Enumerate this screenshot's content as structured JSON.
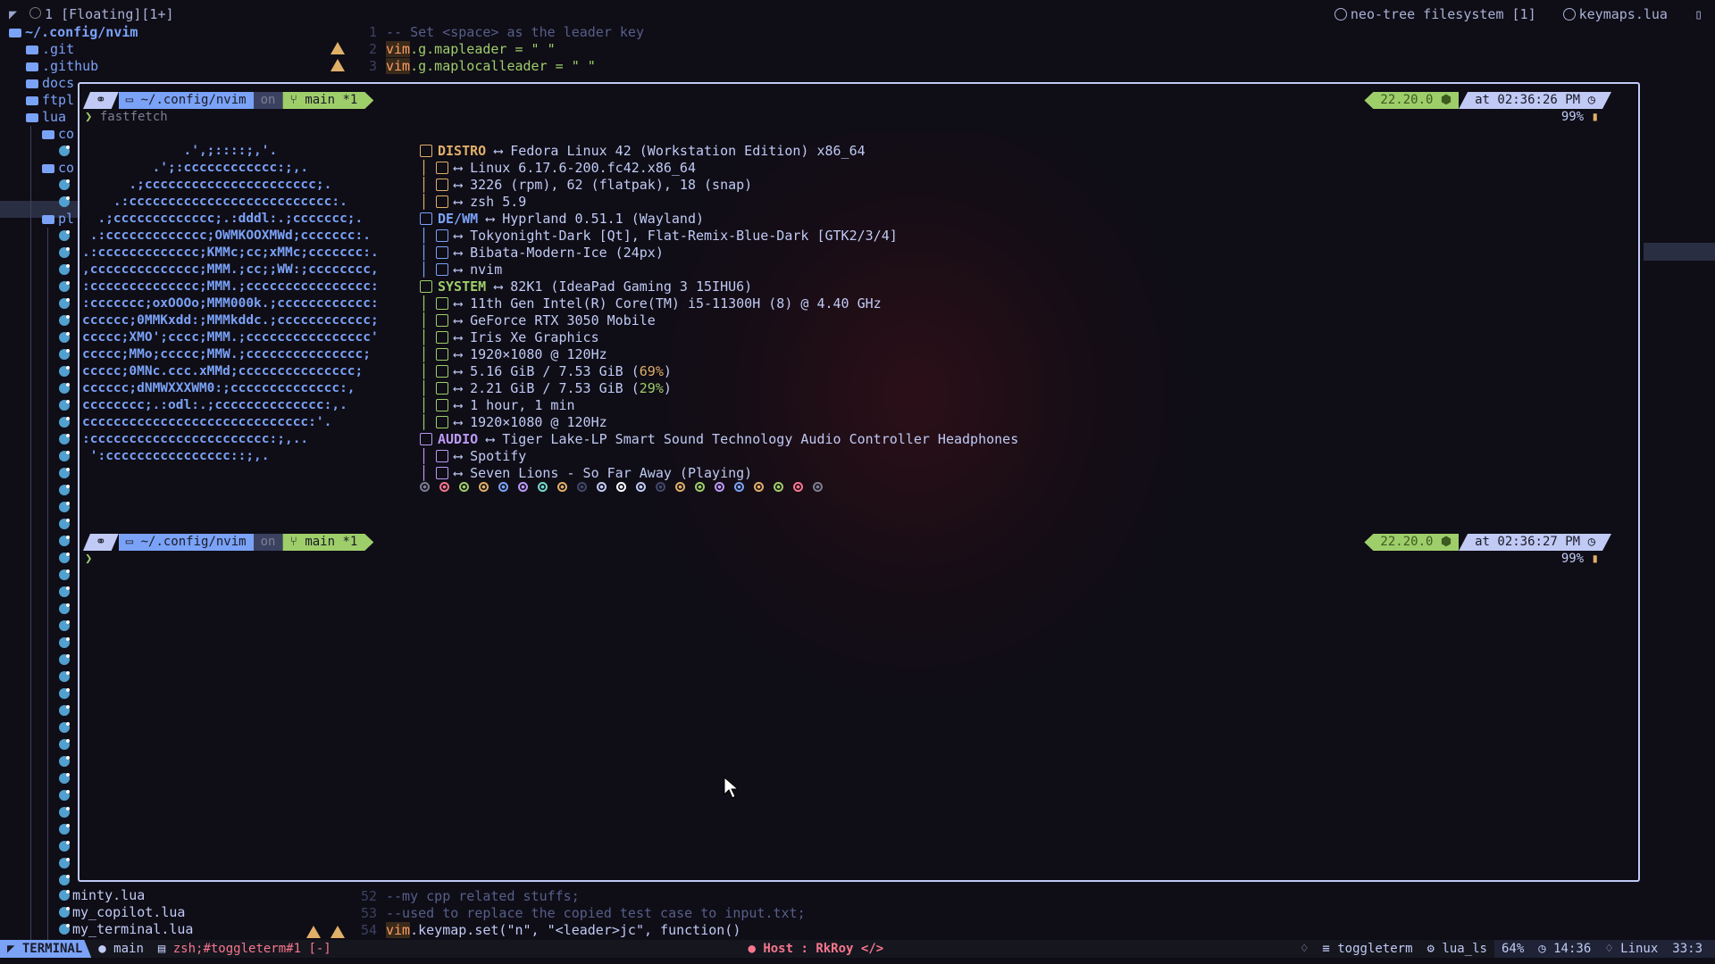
{
  "top_bar": {
    "workspace": "1 [Floating][1+]",
    "tabs": [
      "neo-tree filesystem [1]",
      "keymaps.lua"
    ]
  },
  "tree": {
    "root": "~/.config/nvim",
    "folders": [
      ".git",
      ".github",
      "docs",
      "ftpl",
      "lua",
      "co",
      "co",
      "pl"
    ],
    "files": [
      "minty.lua",
      "my_copilot.lua",
      "my_terminal.lua"
    ]
  },
  "editor": {
    "top_lines": [
      {
        "n": "1",
        "text": "-- Set <space> as the leader key"
      },
      {
        "n": "2",
        "kw": "vim",
        "text": ".g.mapleader = \" \""
      },
      {
        "n": "3",
        "kw": "vim",
        "text": ".g.maplocalleader = \" \""
      }
    ],
    "bottom_lines": [
      {
        "n": "52",
        "text": "--my cpp related stuffs;"
      },
      {
        "n": "53",
        "text": "--used to replace the copied test case to input.txt;"
      },
      {
        "n": "54",
        "kw": "vim",
        "text": ".keymap.set(\"n\", \"<leader>jc\", function()"
      }
    ]
  },
  "terminal": {
    "prompt": {
      "dir": "~/.config/nvim",
      "on": "on",
      "branch": "main *1",
      "node": "22.20.0",
      "time1": "at 02:36:26 PM",
      "time2": "at 02:36:27 PM",
      "battery": "99%"
    },
    "command": "fastfetch",
    "ascii": [
      "             .',;::::;,'.",
      "         .';:cccccccccccc:;,.",
      "      .;cccccccccccccccccccccc;.",
      "    .:cccccccccccccccccccccccccc:.",
      "  .;ccccccccccccc;.:dddl:.;ccccccc;.",
      " .:ccccccccccccc;OWMKOOXMWd;ccccccc:.",
      ".:ccccccccccccc;KMMc;cc;xMMc;ccccccc:.",
      ",cccccccccccccc;MMM.;cc;;WW:;cccccccc,",
      ":cccccccccccccc;MMM.;cccccccccccccccc:",
      ":ccccccc;oxOOOo;MMM000k.;cccccccccccc:",
      "cccccc;0MMKxdd:;MMMkddc.;cccccccccccc;",
      "ccccc;XMO';cccc;MMM.;cccccccccccccccc'",
      "ccccc;MMo;ccccc;MMW.;ccccccccccccccc;",
      "ccccc;0MNc.ccc.xMMd;ccccccccccccccc;",
      "cccccc;dNMWXXXWM0:;cccccccccccccc:,",
      "cccccccc;.:odl:.;cccccccccccccc:,.",
      "ccccccccccccccccccccccccccccc:'.",
      ":ccccccccccccccccccccccc:;,..",
      " ':cccccccccccccccc::;,."
    ],
    "info": [
      {
        "head": "DISTRO",
        "text": "Fedora Linux 42 (Workstation Edition) x86_64",
        "color": "#e0af68"
      },
      {
        "sub": true,
        "text": "Linux 6.17.6-200.fc42.x86_64",
        "color": "#e0af68"
      },
      {
        "sub": true,
        "text": "3226 (rpm), 62 (flatpak), 18 (snap)",
        "color": "#e0af68"
      },
      {
        "sub": true,
        "text": "zsh 5.9",
        "color": "#e0af68"
      },
      {
        "head": "DE/WM",
        "text": "Hyprland 0.51.1 (Wayland)",
        "color": "#7aa2f7"
      },
      {
        "sub": true,
        "text": "Tokyonight-Dark [Qt], Flat-Remix-Blue-Dark [GTK2/3/4]",
        "color": "#7aa2f7"
      },
      {
        "sub": true,
        "text": "Bibata-Modern-Ice (24px)",
        "color": "#7aa2f7"
      },
      {
        "sub": true,
        "text": "nvim",
        "color": "#7aa2f7"
      },
      {
        "head": "SYSTEM",
        "text": "82K1 (IdeaPad Gaming 3 15IHU6)",
        "color": "#9ece6a"
      },
      {
        "sub": true,
        "text": "11th Gen Intel(R) Core(TM) i5-11300H (8) @ 4.40 GHz",
        "color": "#9ece6a"
      },
      {
        "sub": true,
        "text": "GeForce RTX 3050 Mobile",
        "color": "#9ece6a"
      },
      {
        "sub": true,
        "text": "Iris Xe Graphics",
        "color": "#9ece6a"
      },
      {
        "sub": true,
        "text": "1920×1080 @ 120Hz",
        "color": "#9ece6a"
      },
      {
        "sub": true,
        "text": "5.16 GiB / 7.53 GiB (",
        "pct": "69%",
        "pct_color": "#e0af68",
        "tail": ")",
        "color": "#9ece6a"
      },
      {
        "sub": true,
        "text": "2.21 GiB / 7.53 GiB (",
        "pct": "29%",
        "pct_color": "#9ece6a",
        "tail": ")",
        "color": "#9ece6a"
      },
      {
        "sub": true,
        "text": "1 hour, 1 min",
        "color": "#9ece6a"
      },
      {
        "sub": true,
        "text": "1920×1080 @ 120Hz",
        "color": "#9ece6a"
      },
      {
        "head": "AUDIO",
        "text": "Tiger Lake-LP Smart Sound Technology Audio Controller Headphones",
        "color": "#bb9af7"
      },
      {
        "sub": true,
        "text": "Spotify",
        "color": "#bb9af7"
      },
      {
        "sub": true,
        "text": "Seven Lions - So Far Away (Playing)",
        "color": "#bb9af7"
      }
    ],
    "color_dots": [
      "#7c7f93",
      "#f7768e",
      "#9ece6a",
      "#e0af68",
      "#7aa2f7",
      "#bb9af7",
      "#73daca",
      "#e0af68",
      "#414868",
      "#c0caf5",
      "#ffffff",
      "#c0caf5",
      "#414868",
      "#e0af68",
      "#9ece6a",
      "#bb9af7",
      "#7aa2f7",
      "#e0af68",
      "#9ece6a",
      "#f7768e",
      "#7c7f93"
    ]
  },
  "statusline": {
    "mode": "TERMINAL",
    "branch": "main",
    "buffer": "zsh;#toggleterm#1 [-]",
    "host": "Host : RkRoy",
    "filetype": "toggleterm",
    "lsp": "lua_ls",
    "percent": "64%",
    "clock": "14:36",
    "os": "Linux",
    "position": "33:3"
  }
}
